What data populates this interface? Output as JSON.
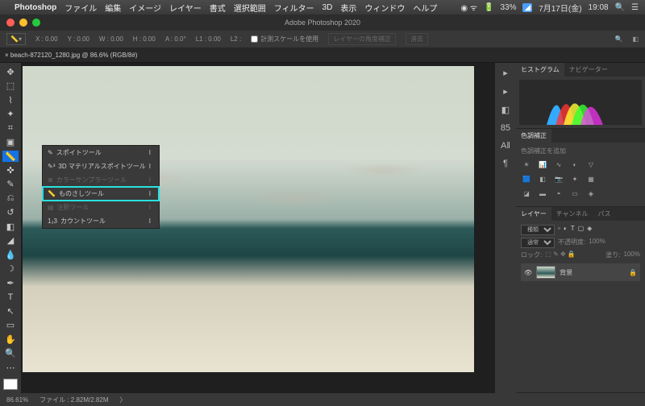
{
  "menubar": {
    "app": "Photoshop",
    "items": [
      "ファイル",
      "編集",
      "イメージ",
      "レイヤー",
      "書式",
      "選択範囲",
      "フィルター",
      "3D",
      "表示",
      "ウィンドウ",
      "ヘルプ"
    ],
    "status": {
      "battery": "33%",
      "dateIcon": "7月17日(金)",
      "time": "19:08"
    }
  },
  "titlebar": {
    "title": "Adobe Photoshop 2020"
  },
  "options": {
    "x": "X : 0.00",
    "y": "Y : 0.00",
    "w": "W : 0.00",
    "h": "H : 0.00",
    "a": "A : 0.0°",
    "l1": "L1 : 0.00",
    "l2": "L2 :",
    "use_scale": "計測スケールを使用",
    "layer_angle": "レイヤーの角度補正",
    "clear": "消去"
  },
  "tab": {
    "label": "×  beach-872120_1280.jpg @ 86.6% (RGB/8#)"
  },
  "flyout": {
    "items": [
      {
        "icon": "eyedrop",
        "label": "スポイトツール",
        "key": "I",
        "dim": false,
        "hl": false
      },
      {
        "icon": "eyedrop3d",
        "label": "3D マテリアルスポイトツール",
        "key": "I",
        "dim": false,
        "hl": false
      },
      {
        "icon": "sampler",
        "label": "カラーサンプラーツール",
        "key": "I",
        "dim": true,
        "hl": false
      },
      {
        "icon": "ruler",
        "label": "ものさしツール",
        "key": "I",
        "dim": false,
        "hl": true
      },
      {
        "icon": "note",
        "label": "注釈ツール",
        "key": "I",
        "dim": true,
        "hl": false
      },
      {
        "icon": "count",
        "label": "カウントツール",
        "key": "I",
        "dim": false,
        "hl": false
      }
    ]
  },
  "rightstrip": [
    "▸",
    "▸",
    "◧",
    "85",
    "A‖",
    "¶"
  ],
  "panels": {
    "hist": {
      "tabs": [
        "ヒストグラム",
        "ナビゲーター"
      ],
      "active": 0
    },
    "adj": {
      "tabs": [
        "色調補正"
      ],
      "hint": "色調補正を追加"
    },
    "layers": {
      "tabs": [
        "レイヤー",
        "チャンネル",
        "パス"
      ],
      "search_placeholder": "種類",
      "blend": "通常",
      "opacity_label": "不透明度:",
      "opacity": "100%",
      "lock": "ロック:",
      "fill_label": "塗り:",
      "fill": "100%",
      "bg_name": "背景"
    }
  },
  "statusbar": {
    "zoom": "86.61%",
    "doc": "ファイル : 2.82M/2.82M"
  }
}
